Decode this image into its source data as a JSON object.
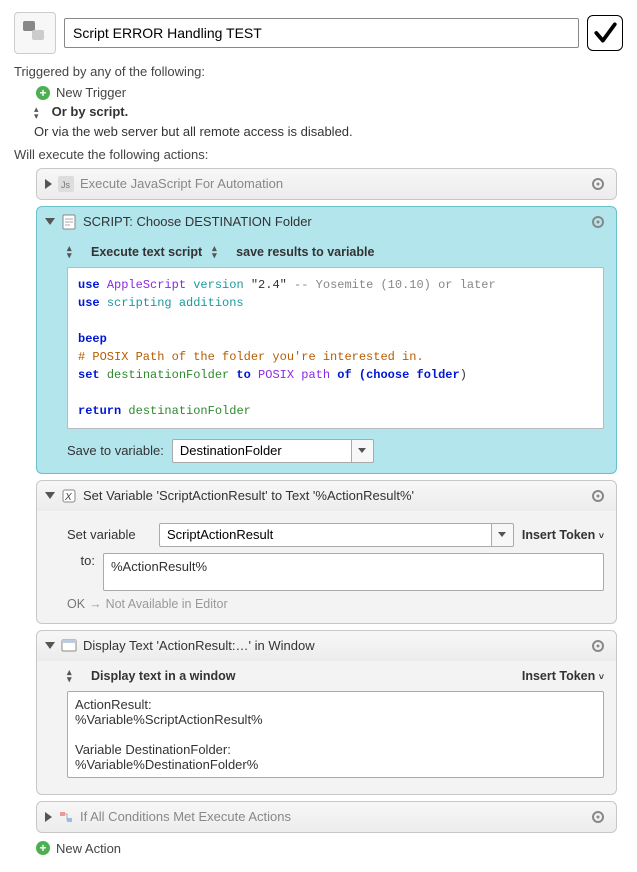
{
  "header": {
    "title": "Script ERROR Handling TEST"
  },
  "triggers": {
    "label": "Triggered by any of the following:",
    "new_trigger": "New Trigger",
    "or_by_script": "Or by script.",
    "or_via_web": "Or via the web server but all remote access is disabled."
  },
  "actions_label": "Will execute the following actions:",
  "new_action": "New Action",
  "insert_token": "Insert Token",
  "actions": {
    "a0": {
      "title": "Execute JavaScript For Automation"
    },
    "a1": {
      "title": "SCRIPT:  Choose DESTINATION Folder",
      "execute_label": "Execute text script",
      "save_label": "save results to variable",
      "script": {
        "l1_use": "use ",
        "l1_as": "AppleScript",
        "l1_ver": " version ",
        "l1_q": "\"2.4\"",
        "l1_c": " -- Yosemite (10.10) or later",
        "l2_use": "use ",
        "l2_sa": "scripting additions",
        "l4_beep": "beep",
        "l5_comm": "# POSIX Path of the folder you're interested in.",
        "l6_set": "set ",
        "l6_var": "destinationFolder",
        "l6_to": " to ",
        "l6_pp": "POSIX path",
        "l6_of": " of (",
        "l6_cf": "choose folder",
        "l6_end": ")",
        "l8_ret": "return ",
        "l8_var": "destinationFolder"
      },
      "save_to_label": "Save to variable:",
      "save_to_value": "DestinationFolder"
    },
    "a2": {
      "title": "Set Variable 'ScriptActionResult' to Text '%ActionResult%'",
      "set_label": "Set variable",
      "set_value": "ScriptActionResult",
      "to_label": "to:",
      "to_value": "%ActionResult%",
      "status_ok": "OK",
      "status_arrow": "→",
      "status_na": "Not Available in Editor"
    },
    "a3": {
      "title": "Display Text 'ActionResult:…' in Window",
      "sub_label": "Display text in a window",
      "content": "ActionResult:\n%Variable%ScriptActionResult%\n\nVariable DestinationFolder:\n%Variable%DestinationFolder%"
    },
    "a4": {
      "title": "If All Conditions Met Execute Actions"
    }
  }
}
